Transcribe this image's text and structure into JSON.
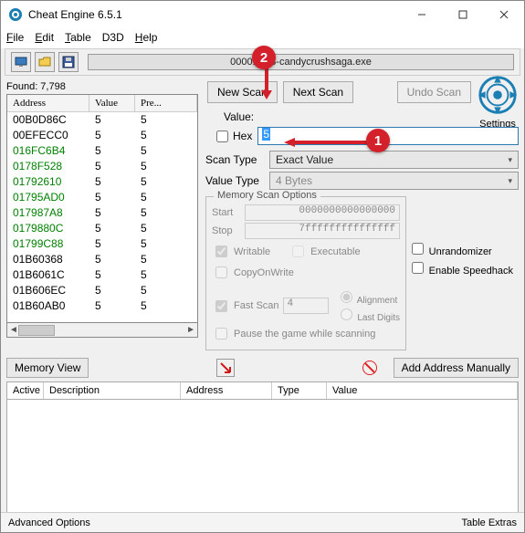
{
  "window": {
    "title": "Cheat Engine 6.5.1"
  },
  "menu": {
    "file": "File",
    "edit": "Edit",
    "table": "Table",
    "d3d": "D3D",
    "help": "Help"
  },
  "toolbar": {
    "process_name": "000018B8-candycrushsaga.exe"
  },
  "left": {
    "found_label": "Found: 7,798",
    "headers": {
      "address": "Address",
      "value": "Value",
      "previous": "Pre..."
    },
    "rows": [
      {
        "addr": "00B0D86C",
        "val": "5",
        "pre": "5",
        "color": "black"
      },
      {
        "addr": "00EFECC0",
        "val": "5",
        "pre": "5",
        "color": "black"
      },
      {
        "addr": "016FC6B4",
        "val": "5",
        "pre": "5",
        "color": "green"
      },
      {
        "addr": "0178F528",
        "val": "5",
        "pre": "5",
        "color": "green"
      },
      {
        "addr": "01792610",
        "val": "5",
        "pre": "5",
        "color": "green"
      },
      {
        "addr": "01795AD0",
        "val": "5",
        "pre": "5",
        "color": "green"
      },
      {
        "addr": "017987A8",
        "val": "5",
        "pre": "5",
        "color": "green"
      },
      {
        "addr": "0179880C",
        "val": "5",
        "pre": "5",
        "color": "green"
      },
      {
        "addr": "01799C88",
        "val": "5",
        "pre": "5",
        "color": "green"
      },
      {
        "addr": "01B60368",
        "val": "5",
        "pre": "5",
        "color": "black"
      },
      {
        "addr": "01B6061C",
        "val": "5",
        "pre": "5",
        "color": "black"
      },
      {
        "addr": "01B606EC",
        "val": "5",
        "pre": "5",
        "color": "black"
      },
      {
        "addr": "01B60AB0",
        "val": "5",
        "pre": "5",
        "color": "black"
      }
    ],
    "memory_view": "Memory View"
  },
  "scan": {
    "new_scan": "New Scan",
    "next_scan": "Next Scan",
    "undo_scan": "Undo Scan",
    "settings": "Settings",
    "value_label": "Value:",
    "hex_label": "Hex",
    "value_input": "5",
    "scan_type_label": "Scan Type",
    "scan_type_value": "Exact Value",
    "value_type_label": "Value Type",
    "value_type_value": "4 Bytes",
    "mem_legend": "Memory Scan Options",
    "start_label": "Start",
    "start_value": "0000000000000000",
    "stop_label": "Stop",
    "stop_value": "7fffffffffffffff",
    "writable": "Writable",
    "executable": "Executable",
    "copyonwrite": "CopyOnWrite",
    "fast_scan": "Fast Scan",
    "fast_scan_value": "4",
    "alignment": "Alignment",
    "last_digits": "Last Digits",
    "pause": "Pause the game while scanning",
    "unrandomizer": "Unrandomizer",
    "speedhack": "Enable Speedhack"
  },
  "mid": {
    "add_manual": "Add Address Manually"
  },
  "cheat_table": {
    "headers": {
      "active": "Active",
      "description": "Description",
      "address": "Address",
      "type": "Type",
      "value": "Value"
    }
  },
  "status": {
    "left": "Advanced Options",
    "right": "Table Extras"
  },
  "annotations": {
    "badge1": "1",
    "badge2": "2"
  }
}
